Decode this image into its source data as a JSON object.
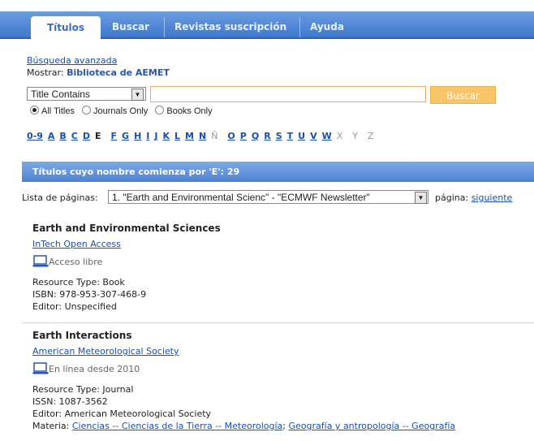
{
  "tabs": [
    {
      "label": "Títulos"
    },
    {
      "label": "Buscar"
    },
    {
      "label": "Revistas suscripción"
    },
    {
      "label": "Ayuda"
    }
  ],
  "advanced_search": "Búsqueda avanzada",
  "show": {
    "label": "Mostrar:",
    "value": "Biblioteca de AEMET"
  },
  "search": {
    "field_select": "Title Contains",
    "query": "",
    "button": "Buscar"
  },
  "filters": [
    {
      "label": "All Titles",
      "checked": true
    },
    {
      "label": "Journals Only",
      "checked": false
    },
    {
      "label": "Books Only",
      "checked": false
    }
  ],
  "alphabet": [
    "0-9",
    "A",
    "B",
    "C",
    "D",
    "E",
    "F",
    "G",
    "H",
    "I",
    "J",
    "K",
    "L",
    "M",
    "N",
    "Ñ",
    "O",
    "P",
    "Q",
    "R",
    "S",
    "T",
    "U",
    "V",
    "W",
    "X",
    "Y",
    "Z"
  ],
  "alphabet_current": "E",
  "alphabet_disabled": [
    "Ñ",
    "X",
    "Y",
    "Z"
  ],
  "results_header": "Títulos cuyo nombre comienza por 'E': 29",
  "pager": {
    "label": "Lista de páginas:",
    "selected": "1. \"Earth and Environmental Scienc\" - \"ECMWF Newsletter\"",
    "page_label": "página:",
    "next": "siguiente"
  },
  "entries": [
    {
      "title": "Earth and Environmental Sciences",
      "provider": "InTech Open Access",
      "access": "Acceso libre",
      "lines": [
        "Resource Type: Book",
        "ISBN: 978-953-307-468-9",
        "Editor: Unspecified"
      ]
    },
    {
      "title": "Earth Interactions",
      "provider": "American Meteorological Society",
      "access": "En línea desde 2010",
      "lines": [
        "Resource Type: Journal",
        "ISSN: 1087-3562",
        "Editor: American Meteorological Society"
      ],
      "subject_label": "Materia:",
      "subjects": [
        "Ciencias -- Ciencias de la Tierra -- Meteorología",
        "Geografía y antropología -- Geografía"
      ]
    }
  ]
}
